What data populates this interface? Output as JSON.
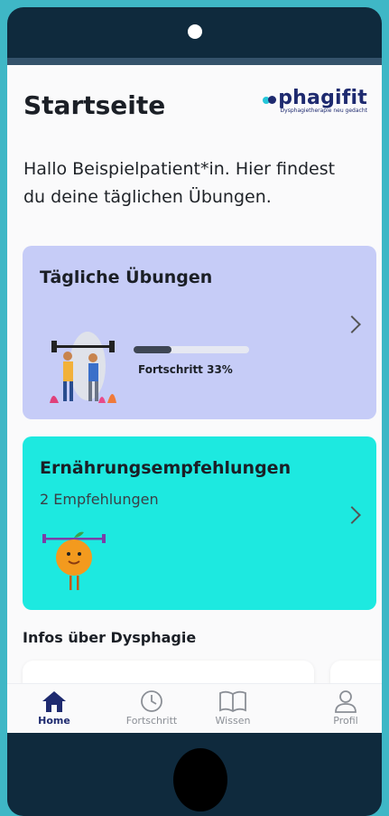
{
  "header": {
    "title": "Startseite"
  },
  "logo": {
    "word": "phagifit",
    "tagline": "Dysphagietherapie neu gedacht"
  },
  "greeting": "Hallo Beispielpatient*in. Hier findest du deine täglichen Übungen.",
  "cards": {
    "daily": {
      "title": "Tägliche Übungen",
      "progress_label": "Fortschritt 33%",
      "progress": 0.33
    },
    "nutrition": {
      "title": "Ernährungsempfehlungen",
      "subtitle": "2 Empfehlungen"
    }
  },
  "info_section": {
    "title": "Infos über Dysphagie"
  },
  "tabs": [
    {
      "label": "Home",
      "icon": "home-icon"
    },
    {
      "label": "Fortschritt",
      "icon": "clock-icon"
    },
    {
      "label": "Wissen",
      "icon": "book-icon"
    },
    {
      "label": "Profil",
      "icon": "user-icon"
    }
  ],
  "colors": {
    "daily_card": "#c6ccf7",
    "nutrition_card": "#1de9e0",
    "accent": "#1e2a6f",
    "background": "#3fb7c6"
  }
}
